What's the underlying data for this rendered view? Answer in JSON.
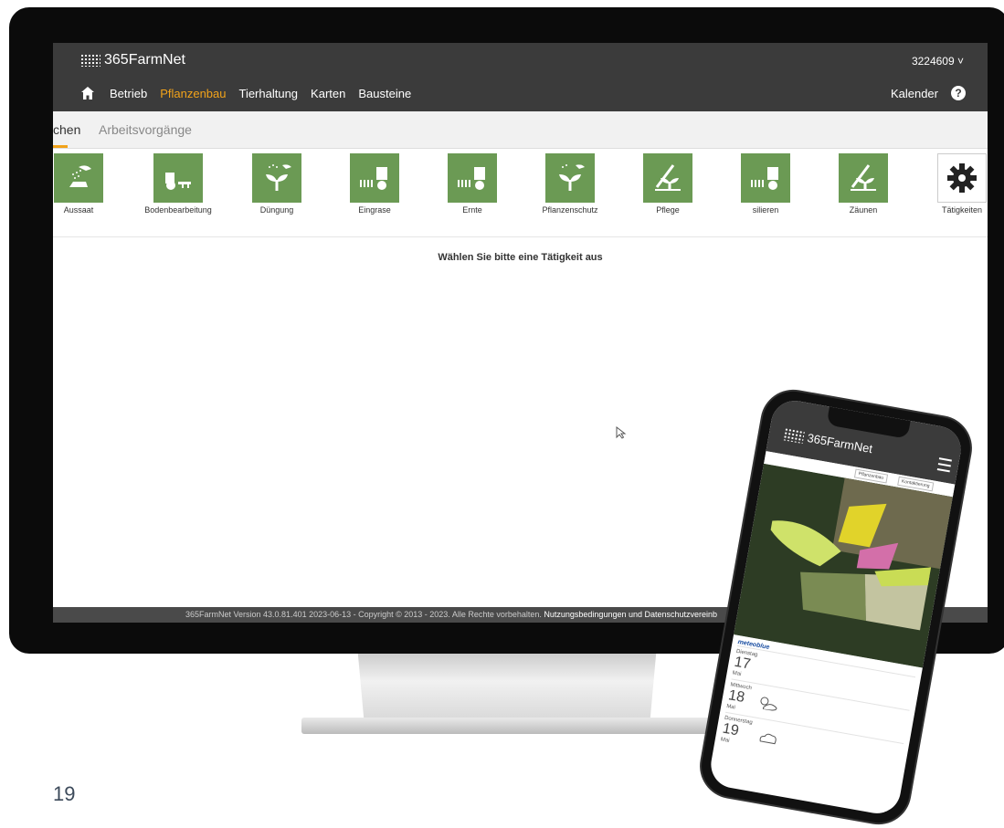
{
  "app": {
    "brand": "365FarmNet",
    "account": "3224609 ˅"
  },
  "nav": {
    "items": [
      "Betrieb",
      "Pflanzenbau",
      "Tierhaltung",
      "Karten",
      "Bausteine"
    ],
    "active": "Pflanzenbau",
    "calendar": "Kalender",
    "help": "?"
  },
  "subtabs": {
    "first": "chen",
    "second": "Arbeitsvorgänge"
  },
  "activities": [
    "Aussaat",
    "Bodenbearbeitung",
    "Düngung",
    "Eingrase",
    "Ernte",
    "Pflanzenschutz",
    "Pflege",
    "silieren",
    "Zäunen",
    "Tätigkeiten"
  ],
  "prompt": "Wählen Sie bitte eine Tätigkeit aus",
  "footer": {
    "text": "365FarmNet Version 43.0.81.401 2023-06-13 - Copyright © 2013 - 2023. Alle Rechte vorbehalten.",
    "links": "Nutzungsbedingungen und Datenschutzvereinb"
  },
  "page_number": "19",
  "phone": {
    "brand": "365FarmNet",
    "tab1": "Pflanzenbau",
    "tab2": "Kontaktierung",
    "weather_brand": "meteoblue",
    "days": [
      {
        "name": "Dienstag",
        "num": "17",
        "month": "Mai"
      },
      {
        "name": "Mittwoch",
        "num": "18",
        "month": "Mai"
      },
      {
        "name": "Donnerstag",
        "num": "19",
        "month": "Mai"
      }
    ]
  },
  "colors": {
    "accent": "#f2a31a",
    "tile": "#6b9a54",
    "topbar": "#3b3b3b"
  }
}
